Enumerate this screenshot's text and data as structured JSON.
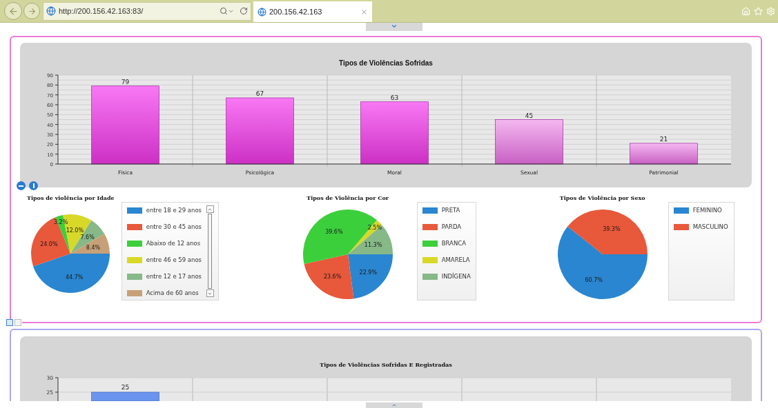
{
  "browser": {
    "address": "http://200.156.42.163:83/",
    "tabs": [
      {
        "title": "200.156.42.163",
        "selected": true
      }
    ]
  },
  "panels": [
    {
      "color": "#ec7ad6",
      "chart": {
        "chart_data": {
          "type": "bar",
          "title": "Tipos de Violências Sofridas",
          "categories": [
            "Física",
            "Psicológica",
            "Moral",
            "Sexual",
            "Patrimonial"
          ],
          "values": [
            79,
            67,
            63,
            45,
            21
          ],
          "ylim": [
            0,
            90
          ],
          "grid": true,
          "yticks": [
            0,
            10,
            20,
            30,
            40,
            50,
            60,
            70,
            80,
            90
          ],
          "data_labels": true
        }
      },
      "pies": [
        {
          "legend_scrollable": true,
          "chart_data": {
            "type": "pie",
            "title": "Tipos de violência por Idade",
            "categories": [
              "entre 18 e 29 anos",
              "entre 30 e 45 anos",
              "Abaixo de 12 anos",
              "entre 46 e 59 anos",
              "entre 12 e 17 anos",
              "Acima de 60 anos"
            ],
            "values": [
              44.7,
              24.0,
              3.2,
              12.0,
              7.6,
              8.4
            ],
            "value_labels": [
              "44.7%",
              "24.0%",
              "3.2%",
              "12.0%",
              "7.6%",
              "8.4%"
            ],
            "colors": [
              "#2a86d0",
              "#e8583a",
              "#3ccf3c",
              "#d8d828",
              "#86b888",
              "#c8a078"
            ]
          }
        },
        {
          "legend_scrollable": false,
          "chart_data": {
            "type": "pie",
            "title": "Tipos de Violência por Cor",
            "categories": [
              "PRETA",
              "PARDA",
              "BRANCA",
              "AMARELA",
              "INDÍGENA"
            ],
            "values": [
              22.9,
              23.6,
              39.6,
              2.5,
              11.3
            ],
            "value_labels": [
              "22.9%",
              "23.6%",
              "39.6%",
              "2.5%",
              "11.3%"
            ],
            "colors": [
              "#2a86d0",
              "#e8583a",
              "#3ccf3c",
              "#d8d828",
              "#86b888"
            ]
          }
        },
        {
          "legend_scrollable": false,
          "chart_data": {
            "type": "pie",
            "title": "Tipos de Violência por Sexo",
            "categories": [
              "FEMININO",
              "MASCULINO"
            ],
            "values": [
              60.7,
              39.3
            ],
            "value_labels": [
              "60.7%",
              "39.3%"
            ],
            "colors": [
              "#2a86d0",
              "#e8583a"
            ]
          }
        }
      ]
    },
    {
      "color": "#a8a8f0",
      "chart": {
        "title": "Tipos de Violências Sofridas E Registradas",
        "axis_labels": [
          "30",
          "25"
        ],
        "bar_label": "25"
      }
    }
  ]
}
